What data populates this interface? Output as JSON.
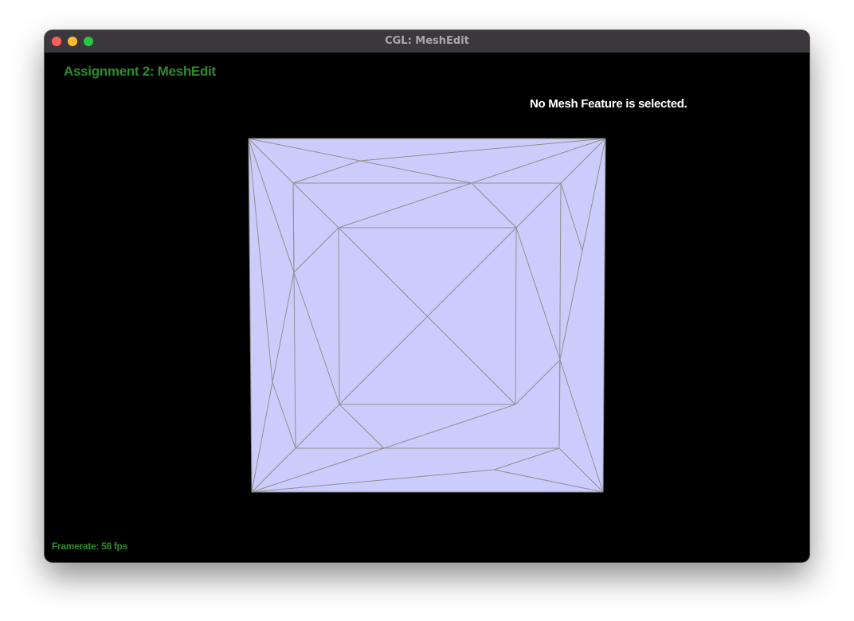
{
  "window": {
    "title": "CGL: MeshEdit"
  },
  "hud": {
    "title": "Assignment 2: MeshEdit",
    "selection_status": "No Mesh Feature is selected.",
    "framerate_label": "Framerate:",
    "framerate_value": "58 fps"
  },
  "colors": {
    "background": "#000000",
    "mesh_fill": "#ccccfc",
    "mesh_edge": "#8f8f8f",
    "hud_green": "#2e8b2e",
    "hud_white": "#ffffff",
    "titlebar": "#3a383c"
  }
}
